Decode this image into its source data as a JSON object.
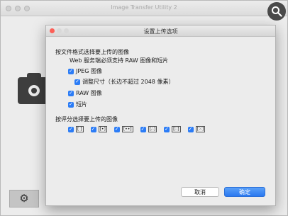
{
  "main_window": {
    "title": "Image Transfer Utility 2",
    "icons": {
      "camera": "camera-icon",
      "settings": "gear-icon",
      "search": "search-icon"
    }
  },
  "dialog": {
    "title": "设置上传选项",
    "format_heading": "按文件格式选择要上传的图像",
    "format_note": "Web 服务端必须支持 RAW 图像和短片",
    "options": {
      "jpeg": {
        "label": "JPEG 图像",
        "checked": true
      },
      "resize": {
        "label": "调整尺寸（长边不超过 2048 像素）",
        "checked": true
      },
      "raw": {
        "label": "RAW 图像",
        "checked": true
      },
      "movie": {
        "label": "短片",
        "checked": true
      }
    },
    "rating_heading": "按评分选择要上传的图像",
    "ratings": [
      {
        "symbol": "[ ]",
        "checked": true
      },
      {
        "symbol": "[•]",
        "checked": true
      },
      {
        "symbol": "[••]",
        "checked": true
      },
      {
        "symbol": "[∴]",
        "checked": true
      },
      {
        "symbol": "[∷]",
        "checked": true
      },
      {
        "symbol": "[⁙]",
        "checked": true
      }
    ],
    "cancel_label": "取消",
    "ok_label": "确定"
  },
  "colors": {
    "accent": "#2b7cf6",
    "close_dot": "#fc5f57",
    "min_dot": "#fdbc2e",
    "max_dot": "#29c840"
  }
}
